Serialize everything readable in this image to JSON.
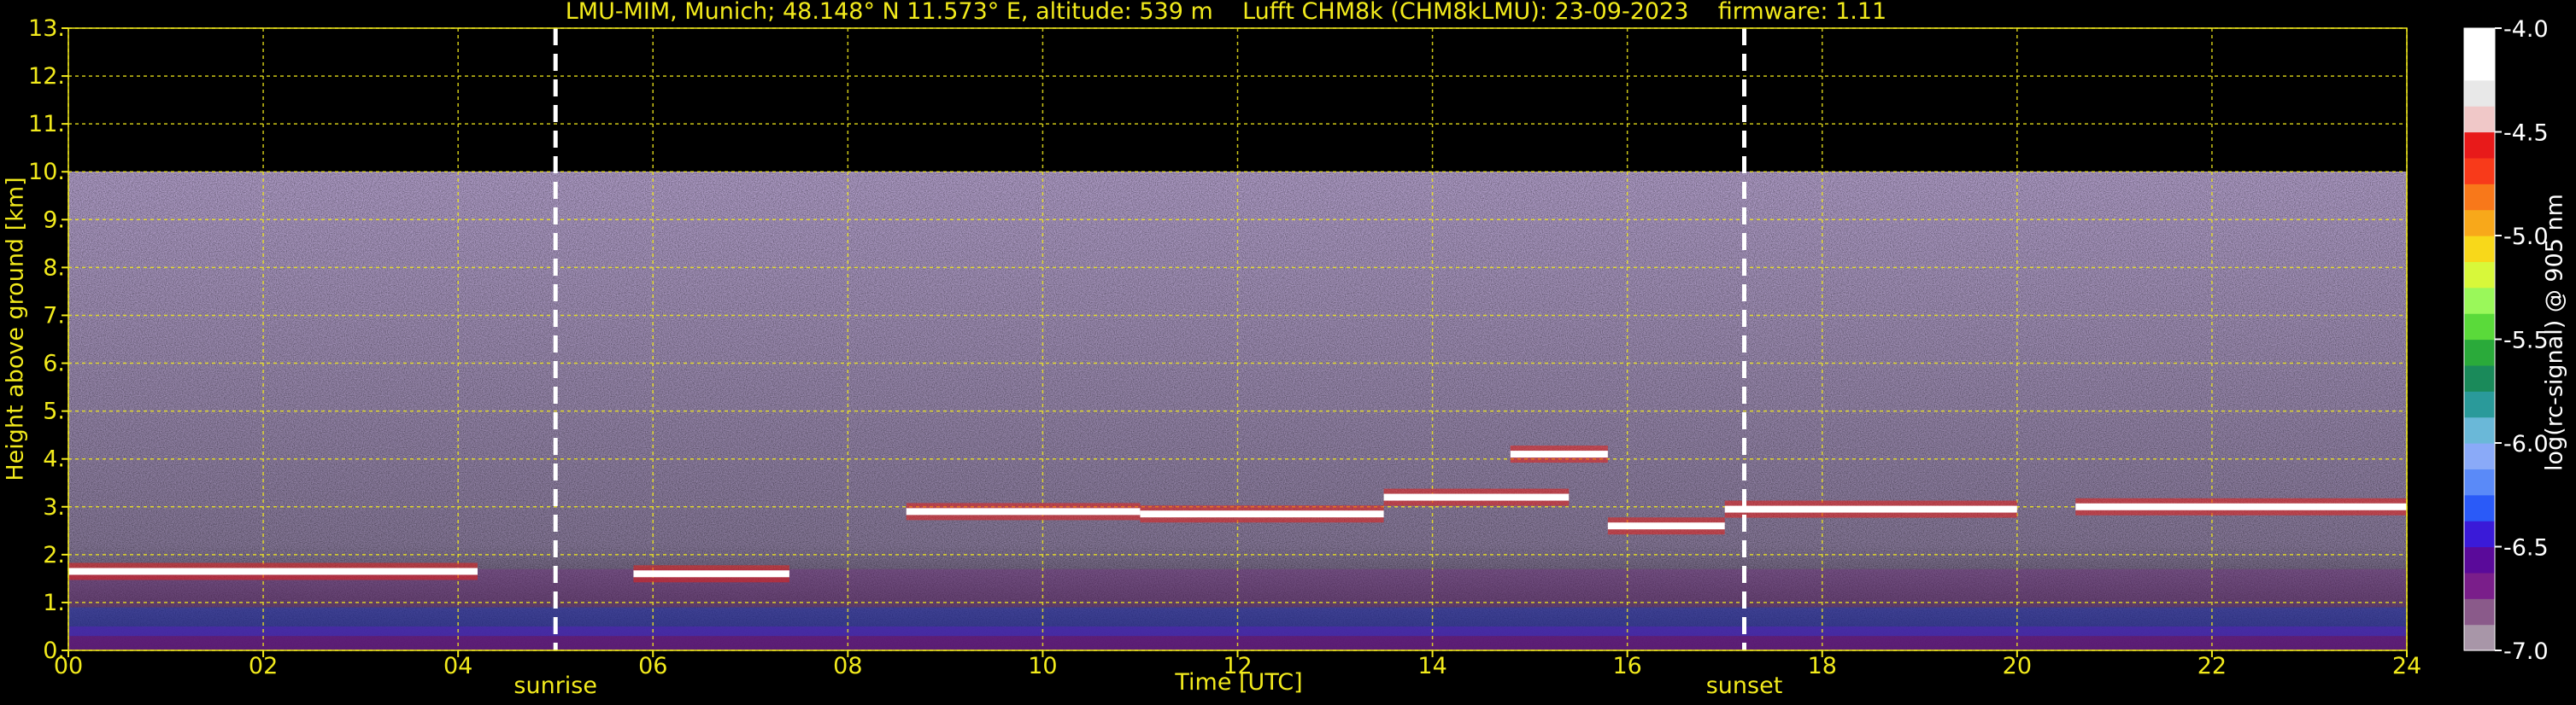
{
  "title": "LMU-MIM, Munich; 48.148° N 11.573° E, altitude: 539 m    Lufft CHM8k (CHM8kLMU): 23-09-2023    firmware: 1.11",
  "chart_data": {
    "type": "heatmap",
    "xlabel": "Time [UTC]",
    "ylabel": "Height above ground [km]",
    "xlim": [
      0,
      24
    ],
    "ylim": [
      0,
      13
    ],
    "xticks": [
      "00",
      "02",
      "04",
      "06",
      "08",
      "10",
      "12",
      "14",
      "16",
      "18",
      "20",
      "22",
      "24"
    ],
    "yticks": [
      "0.",
      "1.",
      "2.",
      "3.",
      "4.",
      "5.",
      "6.",
      "7.",
      "8.",
      "9.",
      "10.",
      "11.",
      "12.",
      "13."
    ],
    "grid": true,
    "data_top_km": 10,
    "events": [
      {
        "label": "sunrise",
        "x": 5.0
      },
      {
        "label": "sunset",
        "x": 17.2
      }
    ],
    "cloud_layers": [
      {
        "x0": 0.0,
        "x1": 4.2,
        "y": 1.65
      },
      {
        "x0": 5.8,
        "x1": 7.4,
        "y": 1.6
      },
      {
        "x0": 8.6,
        "x1": 11.0,
        "y": 2.9
      },
      {
        "x0": 11.0,
        "x1": 13.5,
        "y": 2.85
      },
      {
        "x0": 13.5,
        "x1": 15.4,
        "y": 3.2
      },
      {
        "x0": 14.8,
        "x1": 15.8,
        "y": 4.1
      },
      {
        "x0": 15.8,
        "x1": 17.0,
        "y": 2.6
      },
      {
        "x0": 17.0,
        "x1": 20.0,
        "y": 2.95
      },
      {
        "x0": 20.6,
        "x1": 24.0,
        "y": 3.0
      }
    ],
    "colorbar": {
      "label": "log(rc-signal) @ 905 nm",
      "ticks": [
        "-4.0",
        "-4.5",
        "-5.0",
        "-5.5",
        "-6.0",
        "-6.5",
        "-7.0"
      ],
      "range": [
        -7.0,
        -4.0
      ],
      "colors": [
        "#a896a8",
        "#8a5a8a",
        "#7a1e8a",
        "#5a0a9a",
        "#3a1ad8",
        "#2a5af8",
        "#5a8af8",
        "#8aaaf8",
        "#6ab8d8",
        "#2a9a9a",
        "#1a8a5a",
        "#2aaa3a",
        "#5ada3a",
        "#9af85a",
        "#d8f83a",
        "#f8d81a",
        "#f8a81a",
        "#f8781a",
        "#f83a1a",
        "#e81a1a",
        "#f0c8c8",
        "#e8e8e8",
        "#ffffff",
        "#ffffff"
      ]
    }
  }
}
